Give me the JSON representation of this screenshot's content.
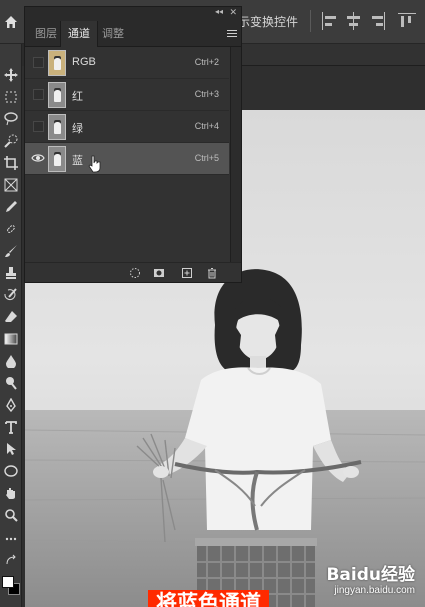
{
  "options_bar": {
    "transform_label": "示变换控件"
  },
  "panel": {
    "tabs": [
      {
        "label": "图层"
      },
      {
        "label": "通道"
      },
      {
        "label": "调整"
      }
    ],
    "active_tab": "通道",
    "channels": [
      {
        "name": "RGB",
        "shortcut": "Ctrl+2",
        "visible": false,
        "selected": false
      },
      {
        "name": "红",
        "shortcut": "Ctrl+3",
        "visible": false,
        "selected": false
      },
      {
        "name": "绿",
        "shortcut": "Ctrl+4",
        "visible": false,
        "selected": false
      },
      {
        "name": "蓝",
        "shortcut": "Ctrl+5",
        "visible": true,
        "selected": true
      }
    ]
  },
  "caption": {
    "text": "将蓝色通道"
  },
  "watermark": {
    "logo": "Baidu经验",
    "url": "jingyan.baidu.com"
  },
  "colors": {
    "caption_bg": "#ff2a00",
    "panel_bg": "#323232",
    "selected_row": "#545454"
  }
}
